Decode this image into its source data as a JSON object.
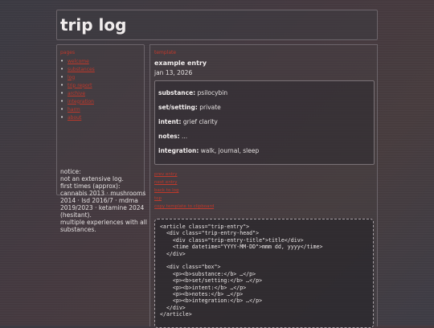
{
  "site": {
    "title": "trip log"
  },
  "sidebar": {
    "heading": "pages",
    "nav": [
      {
        "label": "welcome"
      },
      {
        "label": "substances"
      },
      {
        "label": "log"
      },
      {
        "label": "trip report"
      },
      {
        "label": "archive"
      },
      {
        "label": "integration"
      },
      {
        "label": "harm"
      },
      {
        "label": "about"
      }
    ],
    "notice": {
      "lines": [
        "notice:",
        "not an extensive log.",
        "first times (approx):",
        "cannabis 2013 · mushrooms",
        "2014 · lsd 2016/7 · mdma",
        "2019/2023 · ketamine 2024",
        "(hesitant).",
        "multiple experiences with all",
        "substances."
      ]
    }
  },
  "main": {
    "heading": "template",
    "entry": {
      "title": "example entry",
      "date": "jan 13, 2026",
      "fields": [
        {
          "key": "substance:",
          "value": "psilocybin"
        },
        {
          "key": "set/setting:",
          "value": "private"
        },
        {
          "key": "intent:",
          "value": "grief clarity"
        },
        {
          "key": "notes:",
          "value": "..."
        },
        {
          "key": "integration:",
          "value": "walk, journal, sleep"
        }
      ]
    },
    "links": [
      {
        "label": "prev entry"
      },
      {
        "label": "next entry"
      },
      {
        "label": "back to log"
      },
      {
        "label": "top"
      },
      {
        "label": "copy template to clipboard"
      }
    ],
    "code_lines": [
      "<article class=\"trip-entry\">",
      "  <div class=\"trip-entry-head\">",
      "    <div class=\"trip-entry-title\">title</div>",
      "    <time datetime=\"YYYY-MM-DD\">mmm dd, yyyy</time>",
      "  </div>",
      "",
      "  <div class=\"box\">",
      "    <p><b>substance:</b> …</p>",
      "    <p><b>set/setting:</b> …</p>",
      "    <p><b>intent:</b> …</p>",
      "    <p><b>notes:</b> …</p>",
      "    <p><b>integration:</b> …</p>",
      "  </div>",
      "</article>"
    ]
  },
  "colors": {
    "link": "#c0392b",
    "border": "#6b646a",
    "text": "#e4e0e0"
  }
}
